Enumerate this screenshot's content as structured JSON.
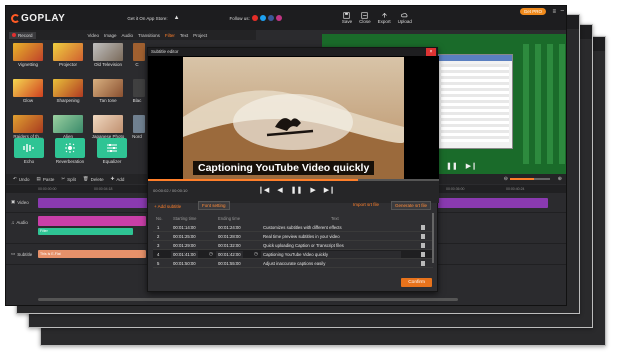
{
  "header": {
    "app_name": "GOPLAY",
    "app_store_text": "Get it On App Store:",
    "follow_us": "Follow us:",
    "save": "Save",
    "close": "Close",
    "export": "Export",
    "upload": "Upload",
    "get_pro": "Get PRO"
  },
  "tabs": {
    "record": "Record",
    "items": [
      "Video",
      "Image",
      "Audio",
      "Transitions",
      "Filter",
      "Text",
      "Project"
    ],
    "active": "Filter"
  },
  "filters": [
    "Vignetting",
    "Projector",
    "Old Television",
    "Glow",
    "Sharpening",
    "Tan tone",
    "Raiders of th...",
    "Alien",
    "Japanese Photo"
  ],
  "filters_cut": [
    "C",
    "Blac",
    "Nord"
  ],
  "audio_effects": [
    "Echo",
    "Reverberation",
    "Equalizer"
  ],
  "toolbar": {
    "items": [
      "Undo",
      "Paste",
      "Split",
      "Delete",
      "Add"
    ]
  },
  "timeline": {
    "ruler": [
      "00:00:00:00",
      "00:00:04:18",
      "00:00:36:00",
      "00:00:40:24"
    ],
    "tracks": [
      "Video",
      "Audio",
      "Subtitle"
    ],
    "filter_clip": "Filter",
    "subtitle_clip": "This Is E-Flat"
  },
  "subtitle_editor": {
    "title": "Subtitle editor",
    "caption": "Captioning YouTube Video quickly",
    "time": "00:00:02 / 00:00:10",
    "add_subtitle": "+ Add subtitle",
    "font_setting": "Font setting",
    "import_srt": "Import srt file",
    "generate_srt": "Generate srt file",
    "columns": [
      "No.",
      "Starting time",
      "Ending time",
      "Text"
    ],
    "rows": [
      {
        "no": "1",
        "start": "00:01:14:00",
        "end": "00:01:24:00",
        "text": "Customizes subtitles with different effects"
      },
      {
        "no": "2",
        "start": "00:01:25:00",
        "end": "00:01:28:00",
        "text": "Real time preview subtitles in your video"
      },
      {
        "no": "3",
        "start": "00:01:29:00",
        "end": "00:01:32:00",
        "text": "Quick uploading Caption or Transcript files"
      },
      {
        "no": "4",
        "start": "00:01:41:00",
        "end": "00:01:42:00",
        "text": "Captioning YouTube Video quickly"
      },
      {
        "no": "5",
        "start": "00:01:50:00",
        "end": "00:01:55:00",
        "text": "Adjust inaccurate captions easily"
      }
    ],
    "confirm": "Confirm"
  },
  "colors": {
    "accent": "#ff7f2a",
    "teal": "#2fc494",
    "video_track": "#8a3ab0",
    "audio_track": "#c93fa8",
    "subtitle_track": "#e6916a"
  }
}
